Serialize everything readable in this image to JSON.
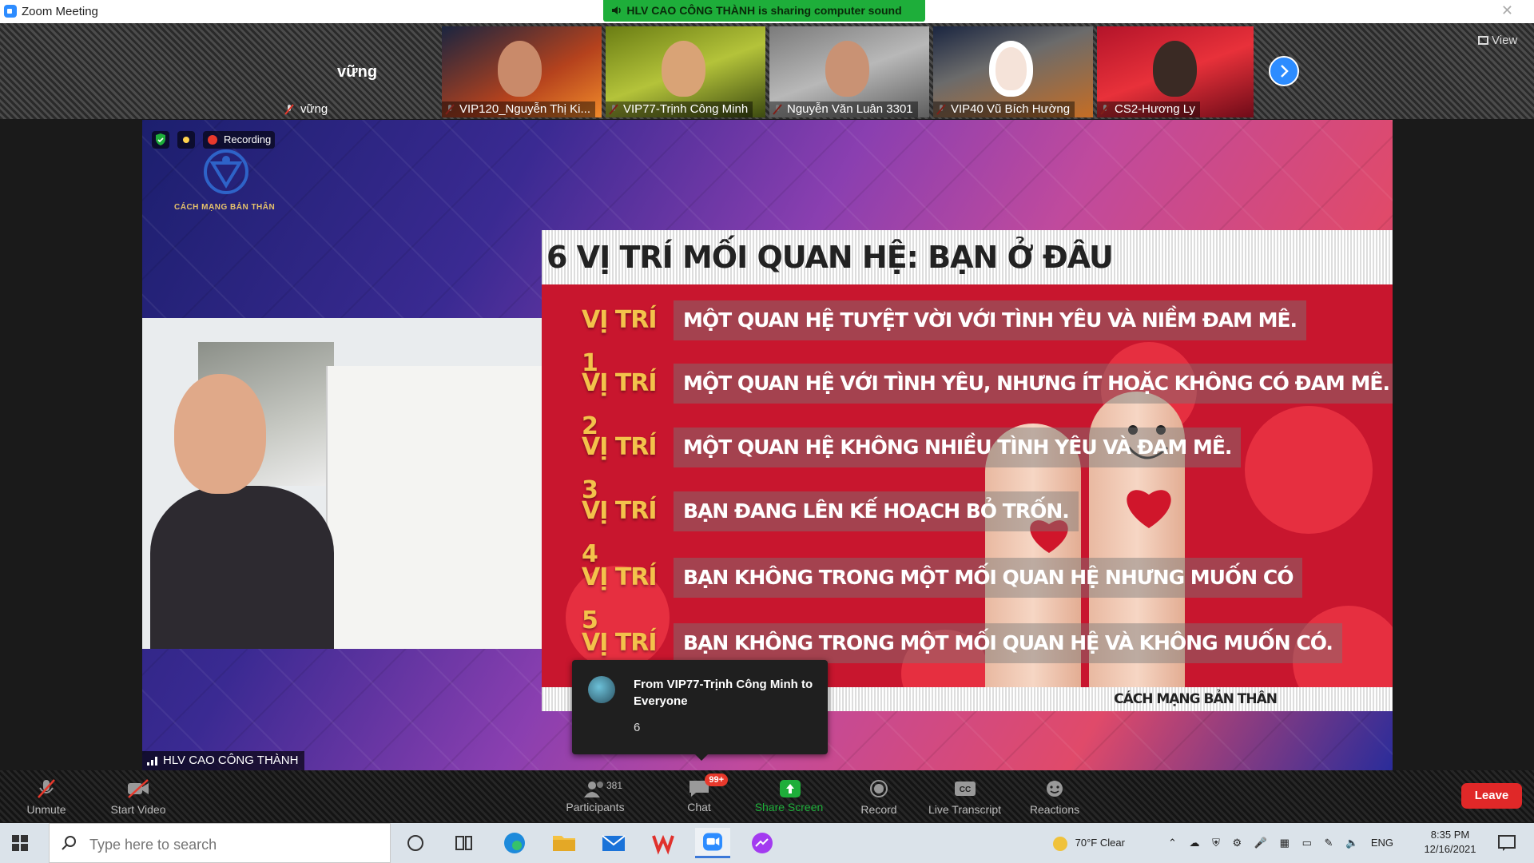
{
  "window": {
    "title": "Zoom Meeting",
    "close_glyph": "✕"
  },
  "share_banner": {
    "text": "HLV CAO CÔNG THÀNH is sharing computer sound"
  },
  "gallery": {
    "name_only_tile": {
      "display_name": "vững",
      "label": "vững"
    },
    "tiles": [
      {
        "label": "VIP120_Nguyễn Thị Ki..."
      },
      {
        "label": "VIP77-Trịnh Công Minh"
      },
      {
        "label": "Nguyễn Văn Luân 3301"
      },
      {
        "label": "VIP40 Vũ Bích Hường"
      },
      {
        "label": "CS2-Hương Ly"
      }
    ],
    "view_label": "View"
  },
  "stage": {
    "recording_label": "Recording",
    "logo_text": "CÁCH MẠNG BẢN THÂN",
    "speaker_name": "HLV CAO CÔNG THÀNH"
  },
  "slide": {
    "title": "6 VỊ TRÍ MỐI QUAN HỆ: BẠN Ở ĐÂU",
    "rows": [
      {
        "label": "VỊ TRÍ 1",
        "text": "MỘT QUAN HỆ TUYỆT VỜI VỚI TÌNH YÊU VÀ NIỀM ĐAM MÊ."
      },
      {
        "label": "VỊ TRÍ 2",
        "text": "MỘT QUAN HỆ VỚI TÌNH YÊU, NHƯNG ÍT HOẶC KHÔNG CÓ ĐAM MÊ."
      },
      {
        "label": "VỊ TRÍ 3",
        "text": "MỘT QUAN HỆ KHÔNG NHIỀU TÌNH YÊU VÀ ĐAM MÊ."
      },
      {
        "label": "VỊ TRÍ 4",
        "text": "BẠN ĐANG LÊN KẾ HOẠCH BỎ TRỐN."
      },
      {
        "label": "VỊ TRÍ 5",
        "text": "BẠN KHÔNG TRONG MỘT MỐI QUAN HỆ NHƯNG MUỐN CÓ"
      },
      {
        "label": "VỊ TRÍ 6",
        "text": "BẠN KHÔNG TRONG MỘT MỐI QUAN HỆ VÀ KHÔNG MUỐN CÓ."
      }
    ],
    "footer_brand": "CÁCH MẠNG BẢN THÂN"
  },
  "chat_popup": {
    "from": "From VIP77-Trịnh Công Minh to Everyone",
    "message": "6"
  },
  "toolbar": {
    "unmute": "Unmute",
    "start_video": "Start Video",
    "participants": "Participants",
    "participants_count": "381",
    "chat": "Chat",
    "chat_badge": "99+",
    "share_screen": "Share Screen",
    "record": "Record",
    "live_transcript": "Live Transcript",
    "reactions": "Reactions",
    "leave": "Leave"
  },
  "taskbar": {
    "search_placeholder": "Type here to search",
    "weather": "70°F Clear",
    "language": "ENG",
    "time": "8:35 PM",
    "date": "12/16/2021"
  },
  "colors": {
    "zoom_blue": "#2d8cff",
    "share_green": "#1eae3a",
    "leave_red": "#e02828",
    "slide_red": "#c8162e",
    "label_gold": "#f3c24b"
  }
}
